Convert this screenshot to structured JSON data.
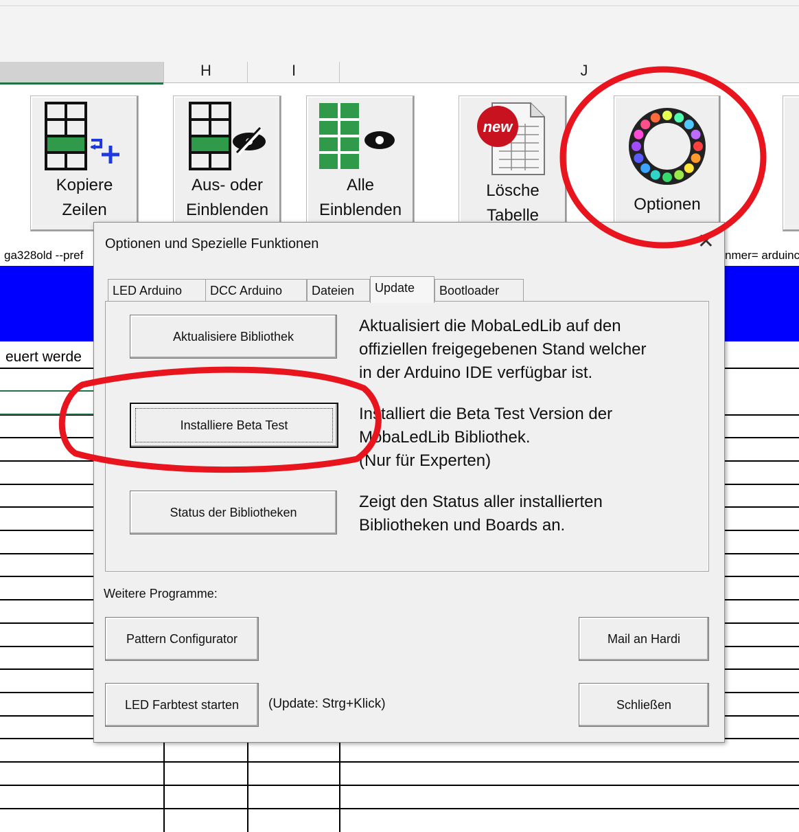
{
  "spreadsheet": {
    "columns": [
      "H",
      "I",
      "J"
    ],
    "cell_left_1": "ga328old --pref",
    "cell_right_1": "nmer= arduinc",
    "cell_left_2": "euert werde"
  },
  "ribbon": {
    "buttons": [
      {
        "label_1": "Kopiere",
        "label_2": "Zeilen",
        "icon": "copy-rows-icon"
      },
      {
        "label_1": "Aus- oder",
        "label_2": "Einblenden",
        "icon": "hide-rows-icon"
      },
      {
        "label_1": "Alle",
        "label_2": "Einblenden",
        "icon": "show-all-icon"
      },
      {
        "label_1": "Lösche",
        "label_2": "Tabelle",
        "icon": "new-table-icon",
        "badge": "new"
      },
      {
        "label_1": "Optionen",
        "icon": "led-ring-icon"
      }
    ]
  },
  "dialog": {
    "title": "Optionen und Spezielle Funktionen",
    "close_glyph": "✕",
    "tabs": [
      "LED Arduino",
      "DCC Arduino",
      "Dateien",
      "Update",
      "Bootloader"
    ],
    "active_tab": "Update",
    "actions": [
      {
        "button": "Aktualisiere Bibliothek",
        "desc": [
          "Aktualisiert die MobaLedLib auf den",
          "offiziellen freigegebenen Stand welcher",
          "in der Arduino IDE verfügbar ist."
        ]
      },
      {
        "button": "Installiere Beta Test",
        "desc": [
          "Installiert die Beta Test Version der",
          "MobaLedLib Bibliothek.",
          "(Nur für Experten)"
        ]
      },
      {
        "button": "Status der Bibliotheken",
        "desc": [
          "Zeigt den Status aller installierten",
          "Bibliotheken und Boards an."
        ]
      }
    ],
    "more_programs_label": "Weitere Programme:",
    "pattern_button": "Pattern Configurator",
    "mail_button": "Mail an Hardi",
    "led_test_button": "LED Farbtest starten",
    "update_hint": "(Update: Strg+Klick)",
    "close_button": "Schließen"
  },
  "colors": {
    "blue_band": "#0000ff",
    "annotation": "#e8141e",
    "grid_green": "#217346"
  }
}
